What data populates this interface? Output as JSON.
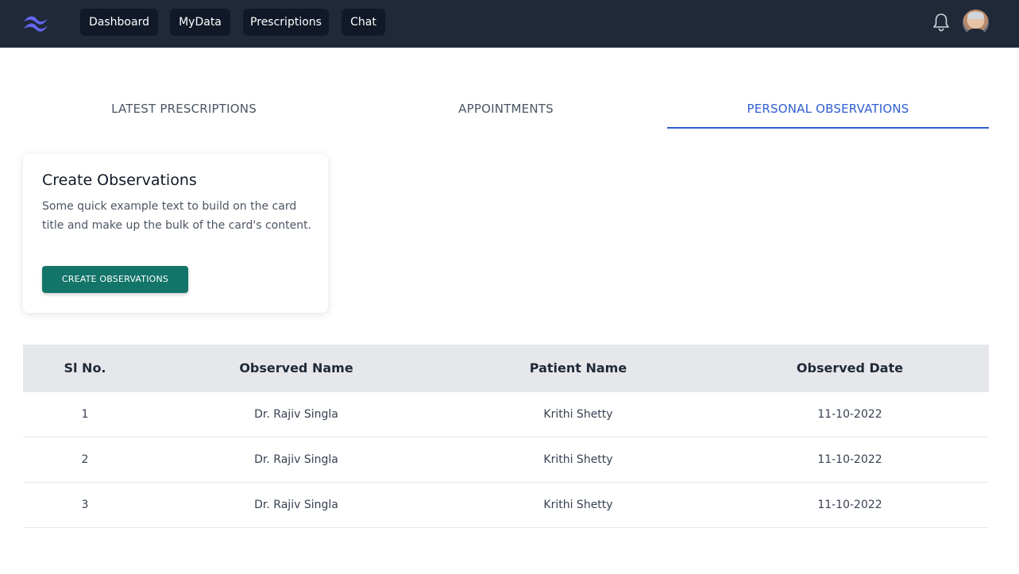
{
  "nav": {
    "items": [
      {
        "label": "Dashboard"
      },
      {
        "label": "MyData"
      },
      {
        "label": "Prescriptions"
      },
      {
        "label": "Chat"
      }
    ],
    "logo_icon": "tailwind-wave-logo",
    "notification_icon": "bell-icon",
    "avatar_icon": "user-avatar"
  },
  "tabs": [
    {
      "label": "LATEST PRESCRIPTIONS",
      "active": false
    },
    {
      "label": "APPOINTMENTS",
      "active": false
    },
    {
      "label": "PERSONAL OBSERVATIONS",
      "active": true
    }
  ],
  "card": {
    "title": "Create Observations",
    "text": "Some quick example text to build on the card title and make up the bulk of the card's content.",
    "button": "CREATE OBSERVATIONS"
  },
  "table": {
    "headers": [
      "Sl No.",
      "Observed Name",
      "Patient Name",
      "Observed Date"
    ],
    "rows": [
      [
        "1",
        "Dr. Rajiv Singla",
        "Krithi Shetty",
        "11-10-2022"
      ],
      [
        "2",
        "Dr. Rajiv Singla",
        "Krithi Shetty",
        "11-10-2022"
      ],
      [
        "3",
        "Dr. Rajiv Singla",
        "Krithi Shetty",
        "11-10-2022"
      ]
    ]
  },
  "colors": {
    "navbar": "#1f2937",
    "active_tab": "#2f5fd0",
    "primary_button": "#137469",
    "logo": "#6366f1"
  }
}
